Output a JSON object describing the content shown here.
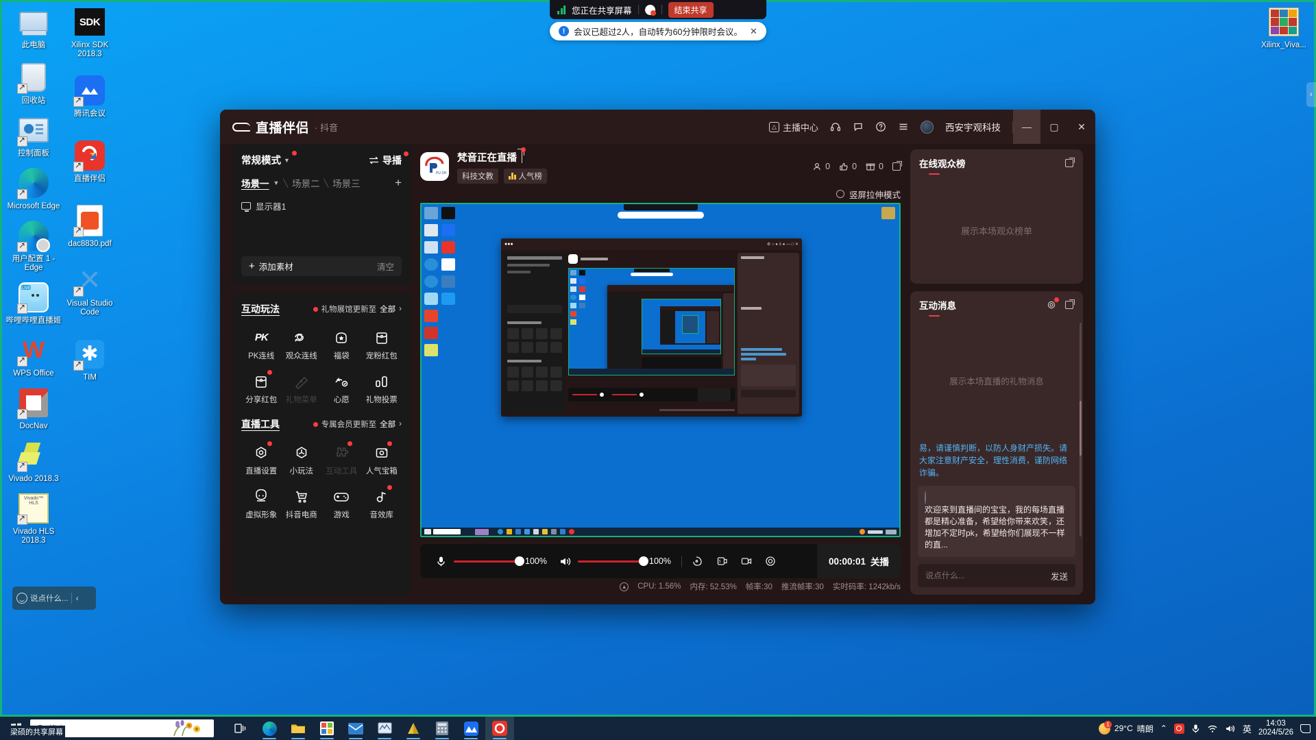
{
  "share_bar": {
    "status_text": "您正在共享屏幕",
    "end_button": "结束共享",
    "toast_text": "会议已超过2人，自动转为60分钟限时会议。",
    "toast_close": "✕"
  },
  "desktop": {
    "icons_col1": [
      {
        "label": "此电脑",
        "icon": "computer-icon"
      },
      {
        "label": "回收站",
        "icon": "recycle-bin-icon"
      },
      {
        "label": "控制面板",
        "icon": "control-panel-icon"
      },
      {
        "label": "Microsoft Edge",
        "icon": "edge-icon"
      },
      {
        "label": "用户配置 1 - Edge",
        "icon": "edge-profile-icon"
      },
      {
        "label": "哔哩哔哩直播姬",
        "icon": "bilibili-live-icon"
      },
      {
        "label": "WPS Office",
        "icon": "wps-icon"
      },
      {
        "label": "DocNav",
        "icon": "docnav-icon"
      },
      {
        "label": "Vivado 2018.3",
        "icon": "vivado-icon"
      },
      {
        "label": "Vivado HLS 2018.3",
        "icon": "vivado-hls-icon"
      }
    ],
    "icons_col2": [
      {
        "label": "Xilinx SDK 2018.3",
        "icon": "xilinx-sdk-icon"
      },
      {
        "label": "腾讯会议",
        "icon": "tencent-meeting-icon"
      },
      {
        "label": "直播伴侣",
        "icon": "douyin-companion-icon"
      },
      {
        "label": "dac8830.pdf",
        "icon": "pdf-file-icon"
      },
      {
        "label": "Visual Studio Code",
        "icon": "vscode-icon"
      },
      {
        "label": "TIM",
        "icon": "tim-icon"
      }
    ],
    "icons_right": [
      {
        "label": "Xilinx_Viva...",
        "icon": "archive-icon"
      }
    ],
    "chat_pill": {
      "placeholder": "说点什么...",
      "arrow": "‹"
    }
  },
  "app": {
    "brand": {
      "name": "直播伴侣",
      "sub": "· 抖音"
    },
    "titlebar": {
      "anchor_center": "主播中心",
      "icons": [
        "chart-icon",
        "headset-icon",
        "comment-icon",
        "help-icon",
        "menu-icon"
      ],
      "user": "西安宇观科技",
      "minimize": "—",
      "maximize": "▢",
      "close": "✕"
    },
    "scene_panel": {
      "mode": "常规模式",
      "director": "导播",
      "scenes": [
        {
          "label": "场景一",
          "active": true
        },
        {
          "label": "场景二",
          "active": false
        },
        {
          "label": "场景三",
          "active": false
        }
      ],
      "add_scene": "+",
      "sources": [
        {
          "label": "显示器1",
          "icon": "monitor-icon"
        }
      ],
      "add_source": "添加素材",
      "clear": "清空"
    },
    "interactive": {
      "title": "互动玩法",
      "more_text": "礼物展馆更新至",
      "more_all": "全部",
      "items": [
        {
          "label": "PK连线",
          "icon": "pk-icon",
          "dim": false,
          "badge": false
        },
        {
          "label": "观众连线",
          "icon": "audience-link-icon",
          "dim": false,
          "badge": false
        },
        {
          "label": "福袋",
          "icon": "lucky-bag-icon",
          "dim": false,
          "badge": false
        },
        {
          "label": "宠粉红包",
          "icon": "fan-redpacket-icon",
          "dim": false,
          "badge": false
        },
        {
          "label": "分享红包",
          "icon": "share-redpacket-icon",
          "dim": false,
          "badge": true
        },
        {
          "label": "礼物菜单",
          "icon": "gift-menu-icon",
          "dim": true,
          "badge": false
        },
        {
          "label": "心愿",
          "icon": "wish-icon",
          "dim": false,
          "badge": false
        },
        {
          "label": "礼物投票",
          "icon": "gift-vote-icon",
          "dim": false,
          "badge": false
        }
      ]
    },
    "live_tools": {
      "title": "直播工具",
      "more_text": "专属会员更新至",
      "more_all": "全部",
      "items": [
        {
          "label": "直播设置",
          "icon": "live-settings-icon",
          "dim": false,
          "badge": true
        },
        {
          "label": "小玩法",
          "icon": "mini-game-icon",
          "dim": false,
          "badge": false
        },
        {
          "label": "互动工具",
          "icon": "interactive-tool-icon",
          "dim": true,
          "badge": true
        },
        {
          "label": "人气宝箱",
          "icon": "popularity-chest-icon",
          "dim": false,
          "badge": true
        },
        {
          "label": "虚拟形象",
          "icon": "avatar-icon",
          "dim": false,
          "badge": false
        },
        {
          "label": "抖音电商",
          "icon": "shop-cart-icon",
          "dim": false,
          "badge": false
        },
        {
          "label": "游戏",
          "icon": "gamepad-icon",
          "dim": false,
          "badge": false
        },
        {
          "label": "音效库",
          "icon": "sound-library-icon",
          "dim": false,
          "badge": true
        }
      ]
    },
    "stream_header": {
      "title": "梵音正在直播",
      "edit_icon": "edit-icon",
      "tags": [
        {
          "label": "科技文教",
          "icon": null
        },
        {
          "label": "人气榜",
          "icon": "rank-bars-icon"
        }
      ],
      "stats": [
        {
          "icon": "viewer-icon",
          "value": "0"
        },
        {
          "icon": "like-icon",
          "value": "0"
        },
        {
          "icon": "gift-icon",
          "value": "0"
        }
      ],
      "popout_icon": "popout-icon"
    },
    "preview": {
      "vertical_mode_label": "竖屏拉伸模式",
      "vertical_mode_selected": false
    },
    "controls": {
      "mic": {
        "icon": "microphone-icon",
        "value": "100%"
      },
      "speaker": {
        "icon": "speaker-icon",
        "value": "100%"
      },
      "icons": [
        {
          "icon": "beauty-icon"
        },
        {
          "icon": "filter-icon"
        },
        {
          "icon": "camera-icon"
        },
        {
          "icon": "settings-gear-icon"
        }
      ],
      "timer": "00:00:01",
      "end_live": "关播"
    },
    "status": {
      "net_icon": "network-icon",
      "cpu": "CPU: 1.56%",
      "memory": "内存: 52.53%",
      "framerate": "帧率:30",
      "push_framerate": "推流帧率:30",
      "bitrate": "实时码率: 1242kb/s"
    },
    "rank_panel": {
      "title": "在线观众榜",
      "popout_icon": "popout-icon",
      "placeholder": "展示本场观众榜单"
    },
    "message_panel": {
      "title": "互动消息",
      "gear_icon": "settings-gear-icon",
      "popout_icon": "popout-icon",
      "placeholder": "展示本场直播的礼物消息",
      "notice": "易，请谨慎判断，以防人身财产损失。请大家注意财产安全，理性消费，谨防网络诈骗。",
      "chat_message": "欢迎来到直播间的宝宝，我的每场直播都是精心准备，希望给你带来欢笑，还增加不定时pk，希望给你们展现不一样的直...",
      "input_placeholder": "说点什么...",
      "send_label": "发送"
    }
  },
  "taskbar": {
    "start_icon": "windows-start-icon",
    "search_placeholder": "搜索",
    "share_tag": "梁硕的共享屏幕",
    "apps": [
      {
        "icon": "task-view-icon",
        "active": false
      },
      {
        "icon": "edge-icon",
        "active": false
      },
      {
        "icon": "file-explorer-icon",
        "active": false
      },
      {
        "icon": "store-icon",
        "active": false
      },
      {
        "icon": "mail-icon",
        "active": false
      },
      {
        "icon": "monitor-app-icon",
        "active": false
      },
      {
        "icon": "acrobat-icon",
        "active": false
      },
      {
        "icon": "calculator-icon",
        "active": false
      },
      {
        "icon": "tencent-meeting-icon",
        "active": false
      },
      {
        "icon": "douyin-companion-icon",
        "active": true
      }
    ],
    "tray": {
      "weather_temp": "29°C",
      "weather_desc": "晴朗",
      "weather_badge": "1",
      "chevron": "⌃",
      "icons": [
        "douyin-tray-icon",
        "microphone-tray-icon",
        "wifi-icon",
        "volume-icon"
      ],
      "ime": "英",
      "time": "14:03",
      "date": "2024/5/26",
      "notification_icon": "notification-icon"
    }
  }
}
